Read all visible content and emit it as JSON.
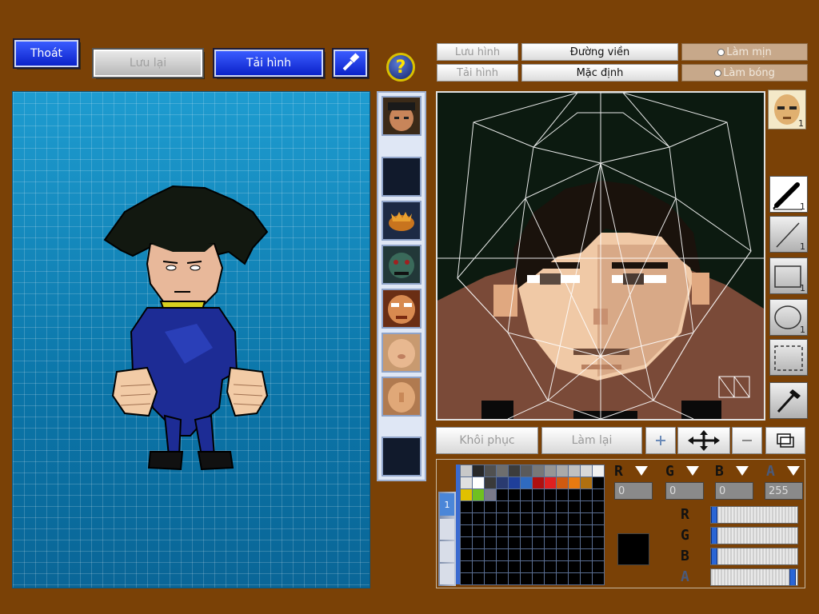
{
  "toolbar_left": {
    "exit_label": "Thoát",
    "save_label": "Lưu lại",
    "load_label": "Tải hình",
    "help_symbol": "?"
  },
  "toolbar_right": {
    "save_image_label": "Lưu hình",
    "load_image_label": "Tải hình",
    "outline_label": "Đường viền",
    "default_label": "Mặc định",
    "smooth_label": "Làm mịn",
    "shade_label": "Làm bóng"
  },
  "actions": {
    "restore_label": "Khôi phục",
    "redo_label": "Làm lại"
  },
  "tools": {
    "pen_size": "1",
    "line_size": "1",
    "rect_size": "1",
    "ellipse_size": "1",
    "part_preview_badge": "1"
  },
  "color": {
    "r_label": "R",
    "g_label": "G",
    "b_label": "B",
    "a_label": "A",
    "r_value": "0",
    "g_value": "0",
    "b_value": "0",
    "a_value": "255",
    "r_level": 0,
    "g_level": 0,
    "b_level": 0,
    "a_level": 1,
    "current": "#000000",
    "palette_tab": "1",
    "swatches": [
      "#c8c8c8",
      "#282828",
      "#505050",
      "#6e6e6e",
      "#3c3c3c",
      "#5a5a5a",
      "#787878",
      "#969696",
      "#aaaaaa",
      "#c0c0c0",
      "#d8d8d8",
      "#f0f0f0",
      "#e0e0e0",
      "#ffffff",
      "#3a3a3a",
      "#2a3b70",
      "#1f3f9a",
      "#2f6bc0",
      "#b01010",
      "#e02020",
      "#d05a10",
      "#e87a10",
      "#b07010",
      "#000000",
      "#e0c000",
      "#70c020",
      "#7a7a8a"
    ]
  },
  "parts": {
    "slots": [
      "face-spike",
      "empty",
      "fish",
      "zombie",
      "face-angry",
      "face-plain",
      "face-plain-2",
      "empty"
    ]
  }
}
